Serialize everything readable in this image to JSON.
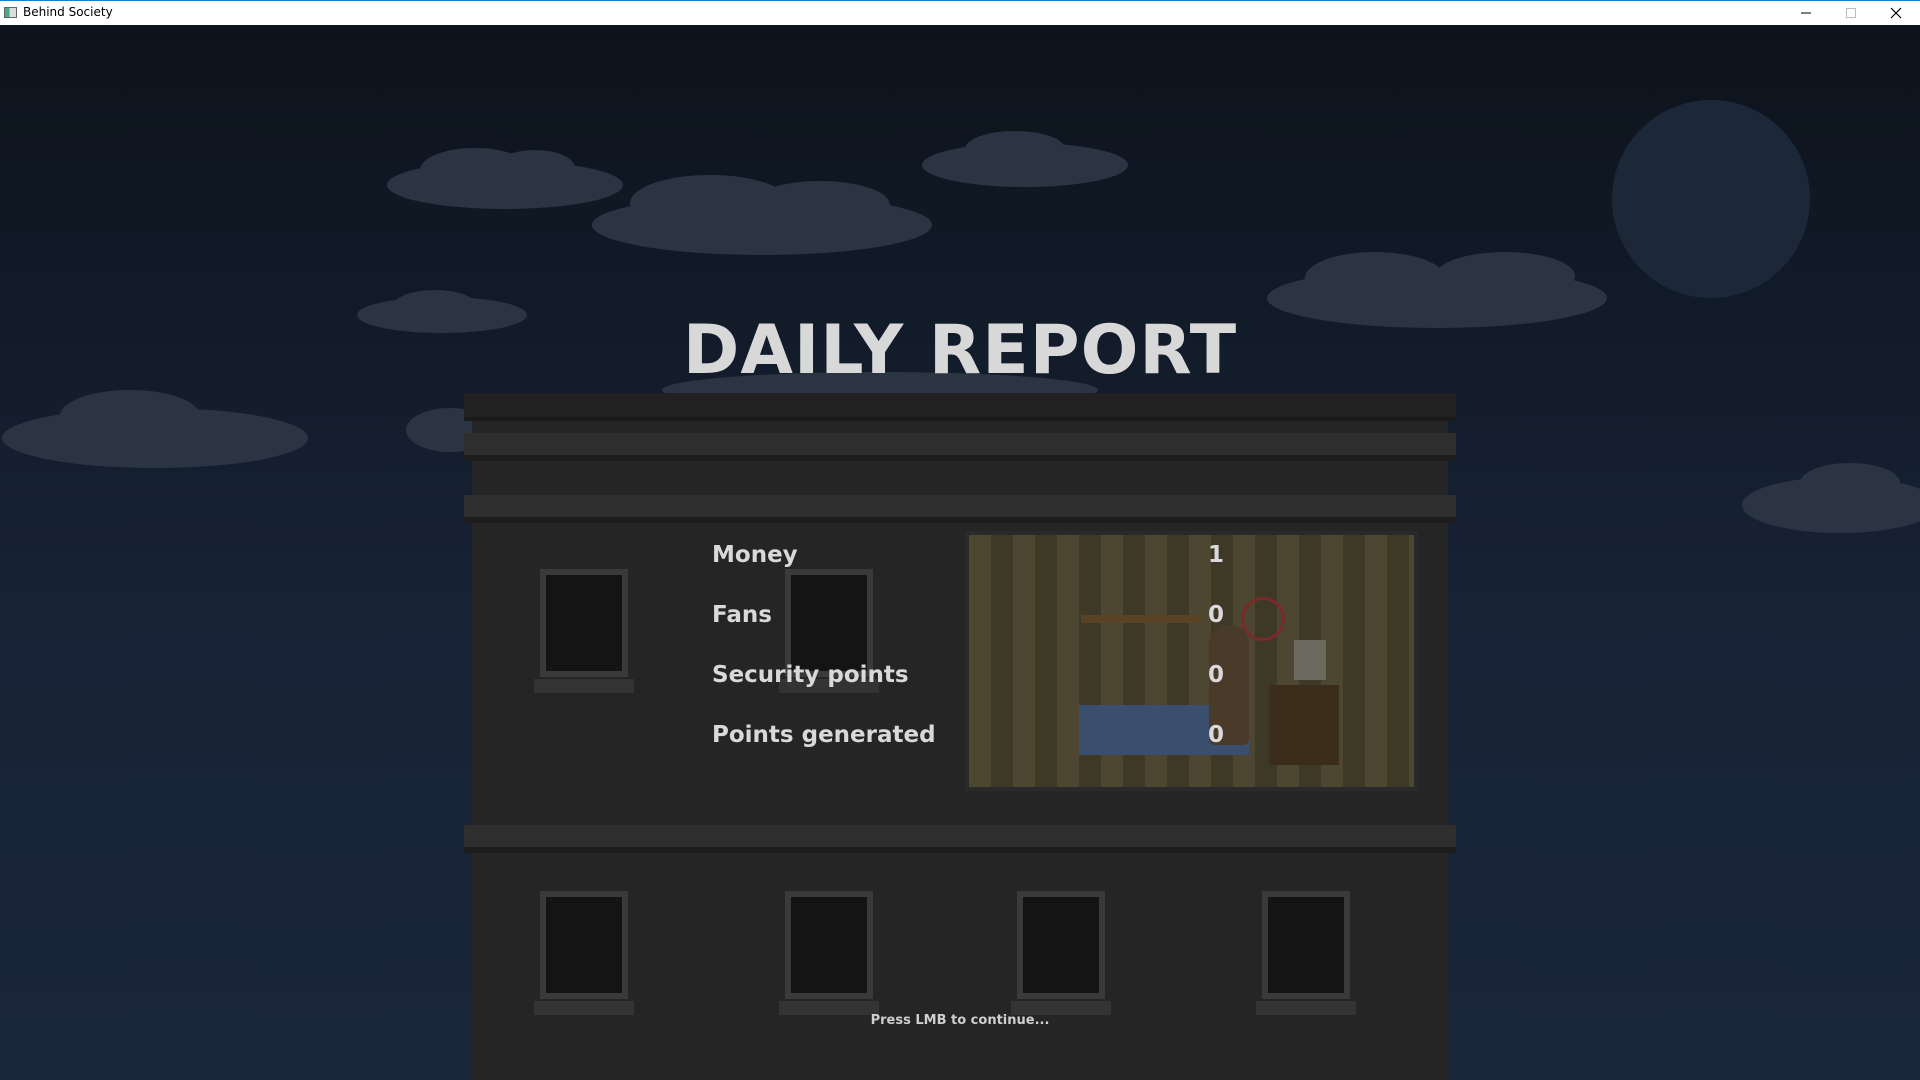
{
  "window": {
    "title": "Behind Society",
    "controls": [
      "minimize-icon",
      "maximize-icon",
      "close-icon"
    ]
  },
  "report": {
    "title": "DAILY REPORT",
    "stats": [
      {
        "label": "Money",
        "value": "1"
      },
      {
        "label": "Fans",
        "value": "0"
      },
      {
        "label": "Security points",
        "value": "0"
      },
      {
        "label": "Points generated",
        "value": "0"
      }
    ],
    "continue_hint": "Press LMB to continue..."
  },
  "colors": {
    "sky": "#0d131c",
    "text": "#d9d9d9",
    "building": "#252525",
    "titlebar_accent": "#1e7fc8"
  }
}
